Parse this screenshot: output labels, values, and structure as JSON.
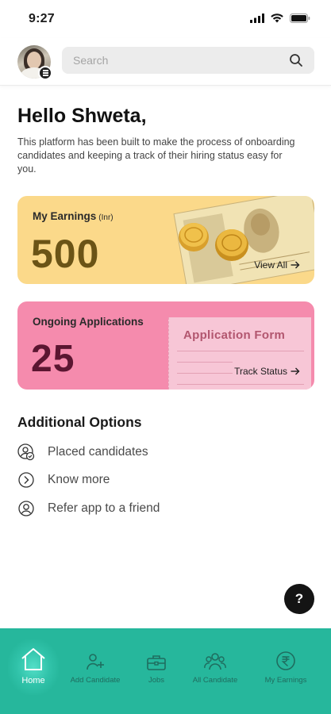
{
  "status_bar": {
    "time": "9:27"
  },
  "header": {
    "search": {
      "placeholder": "Search"
    }
  },
  "greeting": "Hello Shweta,",
  "intro_text": "This platform has been built to make the process of onboarding candidates and keeping a track of their hiring status easy for you.",
  "earnings_card": {
    "title": "My Earnings",
    "unit": "(Inr)",
    "value": "500",
    "link": "View All",
    "color": "#fbd98a"
  },
  "applications_card": {
    "title": "Ongoing Applications",
    "value": "25",
    "link": "Track Status",
    "form_title": "Application Form",
    "color": "#f58bad"
  },
  "additional_options": {
    "title": "Additional Options",
    "items": [
      {
        "label": "Placed candidates",
        "icon": "placed-candidates-icon"
      },
      {
        "label": "Know more",
        "icon": "chevron-circle-icon"
      },
      {
        "label": "Refer app to a friend",
        "icon": "refer-friend-icon"
      }
    ]
  },
  "help_button": {
    "label": "?"
  },
  "bottom_nav": {
    "color": "#26b79c",
    "items": [
      {
        "label": "Home",
        "icon": "home-icon",
        "active": true
      },
      {
        "label": "Add Candidate",
        "icon": "add-user-icon",
        "active": false
      },
      {
        "label": "Jobs",
        "icon": "briefcase-icon",
        "active": false
      },
      {
        "label": "All Candidate",
        "icon": "group-icon",
        "active": false
      },
      {
        "label": "My Earnings",
        "icon": "rupee-icon",
        "active": false
      }
    ]
  }
}
